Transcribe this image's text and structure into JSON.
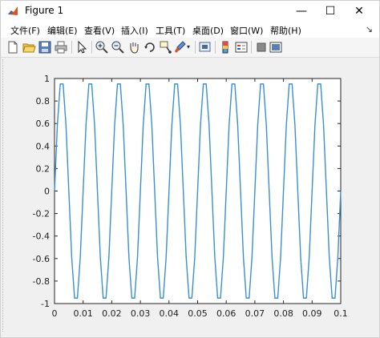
{
  "window": {
    "title": "Figure 1",
    "controls": {
      "minimize": "—",
      "maximize": "☐",
      "close": "✕"
    }
  },
  "menu": {
    "items": [
      {
        "label": "文件(F)"
      },
      {
        "label": "编辑(E)"
      },
      {
        "label": "查看(V)"
      },
      {
        "label": "插入(I)"
      },
      {
        "label": "工具(T)"
      },
      {
        "label": "桌面(D)"
      },
      {
        "label": "窗口(W)"
      },
      {
        "label": "帮助(H)"
      }
    ],
    "overflow_arrow": "↘"
  },
  "toolbar": {
    "icons": [
      "new-figure-icon",
      "open-file-icon",
      "save-icon",
      "print-icon",
      "pointer-icon",
      "zoom-in-icon",
      "zoom-out-icon",
      "rotate-3d-icon",
      "data-cursor-icon",
      "brush-icon",
      "brush-dropdown-icon",
      "link-plot-icon",
      "insert-colorbar-icon",
      "insert-legend-icon",
      "hide-plot-tools-icon",
      "show-plot-tools-icon"
    ]
  },
  "chart_data": {
    "type": "line",
    "title": "",
    "xlabel": "",
    "ylabel": "",
    "xlim": [
      0,
      0.1
    ],
    "ylim": [
      -1,
      1
    ],
    "xticks": [
      "0",
      "0.01",
      "0.02",
      "0.03",
      "0.04",
      "0.05",
      "0.06",
      "0.07",
      "0.08",
      "0.09",
      "0.1"
    ],
    "yticks": [
      "1",
      "0.8",
      "0.6",
      "0.4",
      "0.2",
      "0",
      "-0.2",
      "-0.4",
      "-0.6",
      "-0.8",
      "-1"
    ],
    "grid": false,
    "series": [
      {
        "color": "#3b8fd0",
        "function": "sin",
        "frequency_hz": 100,
        "sample_rate_hz": 1000,
        "x_start": 0,
        "x_end": 0.1
      }
    ]
  }
}
